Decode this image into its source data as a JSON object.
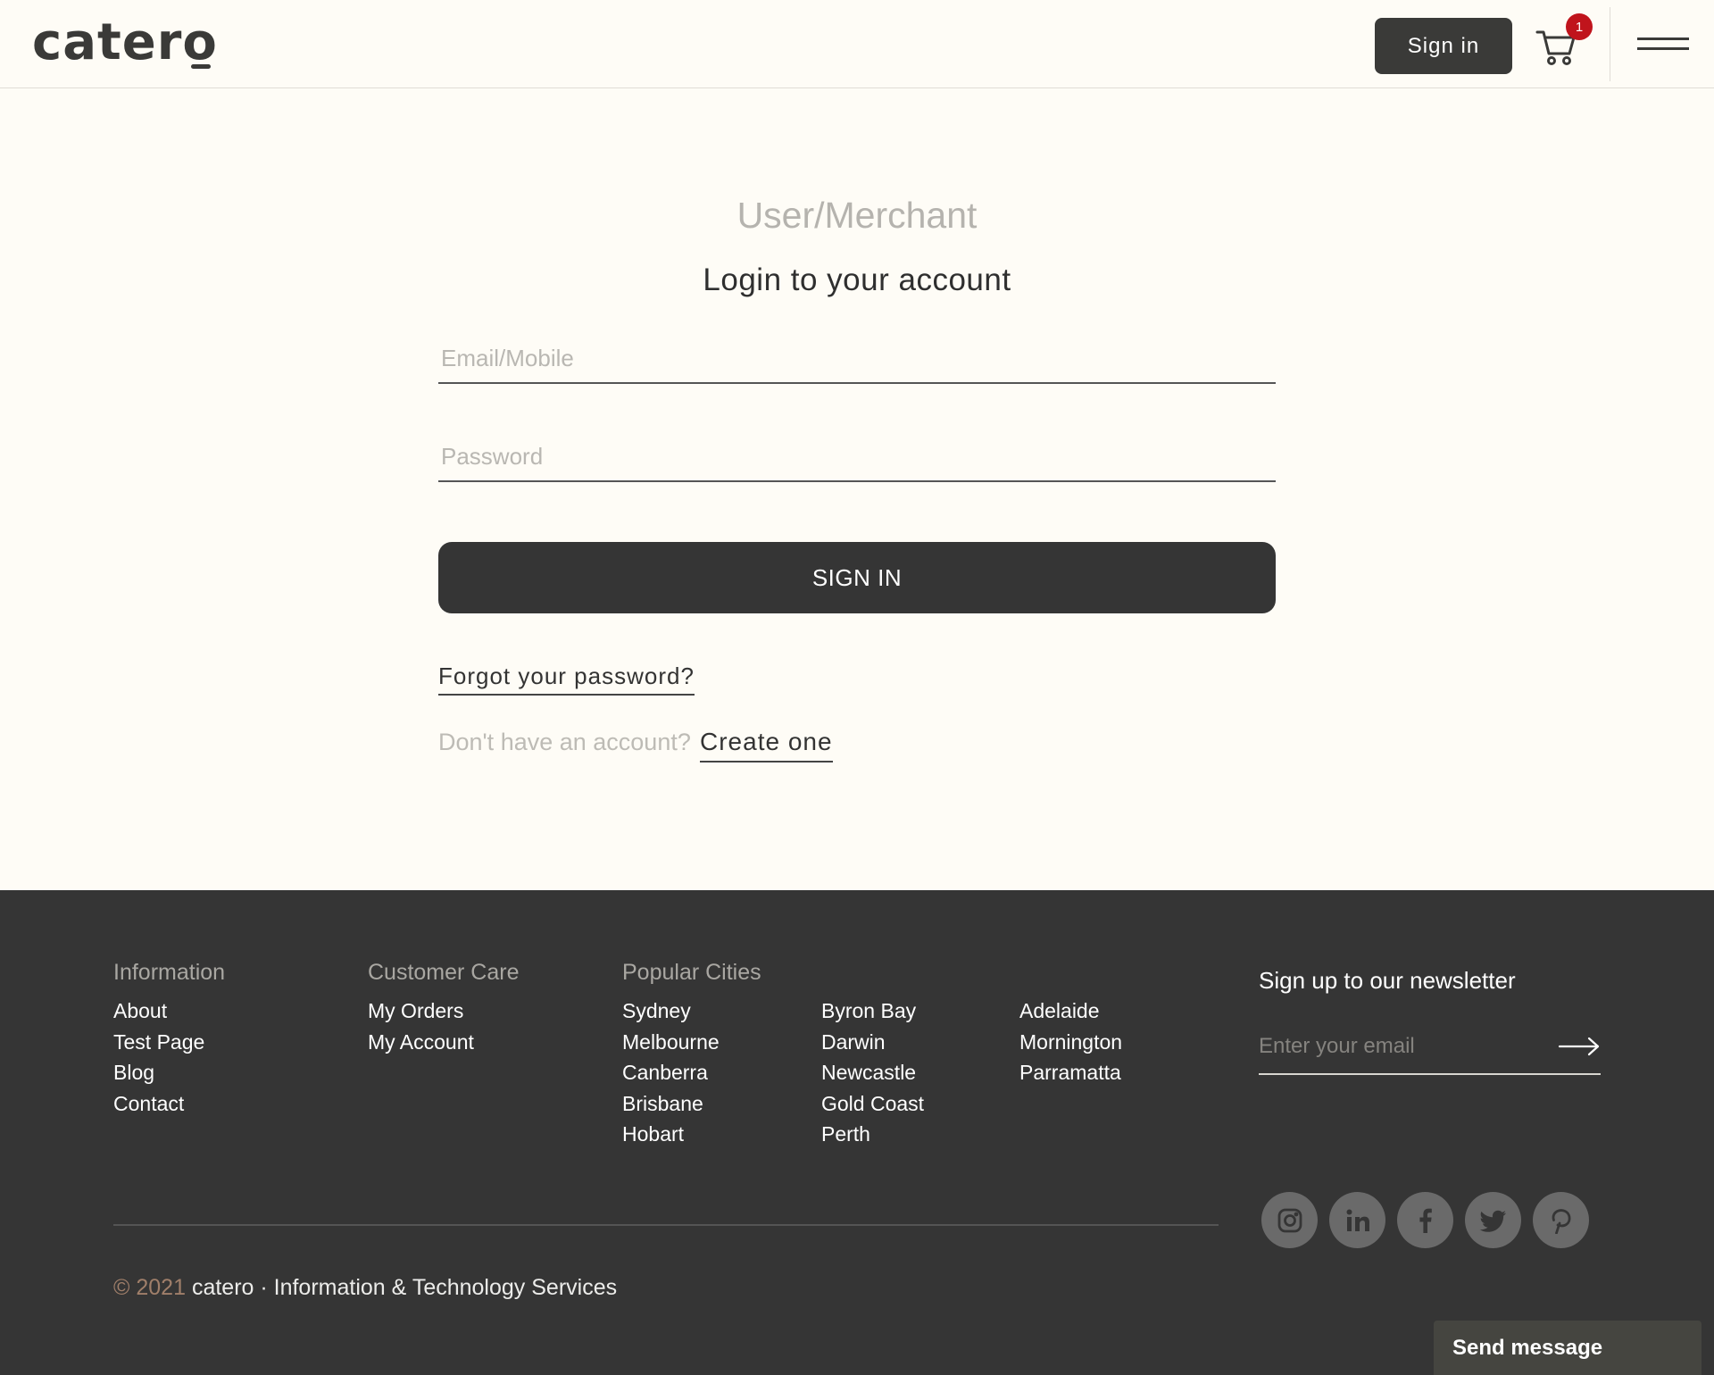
{
  "header": {
    "logo": "catero",
    "signin_label": "Sign in",
    "cart_count": "1"
  },
  "login": {
    "role_title": "User/Merchant",
    "title": "Login to your account",
    "email_placeholder": "Email/Mobile",
    "password_placeholder": "Password",
    "signin_button": "SIGN IN",
    "forgot_password": "Forgot your password?",
    "no_account_text": "Don't have an account?",
    "create_link": "Create one"
  },
  "footer": {
    "information": {
      "heading": "Information",
      "links": [
        "About",
        "Test Page",
        "Blog",
        "Contact"
      ]
    },
    "customer_care": {
      "heading": "Customer Care",
      "links": [
        "My Orders",
        "My Account"
      ]
    },
    "popular_cities": {
      "heading": "Popular Cities",
      "col1": [
        "Sydney",
        "Melbourne",
        "Canberra",
        "Brisbane",
        "Hobart"
      ],
      "col2": [
        "Byron Bay",
        "Darwin",
        "Newcastle",
        "Gold Coast",
        "Perth"
      ],
      "col3": [
        "Adelaide",
        "Mornington",
        "Parramatta"
      ]
    },
    "newsletter": {
      "title": "Sign up to our newsletter",
      "placeholder": "Enter your email"
    },
    "social": [
      "instagram-icon",
      "linkedin-icon",
      "facebook-icon",
      "twitter-icon",
      "pinterest-icon"
    ],
    "copyright_year": "© 2021",
    "copyright_text": "catero · Information & Technology Services",
    "send_message": "Send message"
  },
  "colors": {
    "page_bg": "#fefcf6",
    "dark": "#353535",
    "badge": "#c0141c"
  }
}
